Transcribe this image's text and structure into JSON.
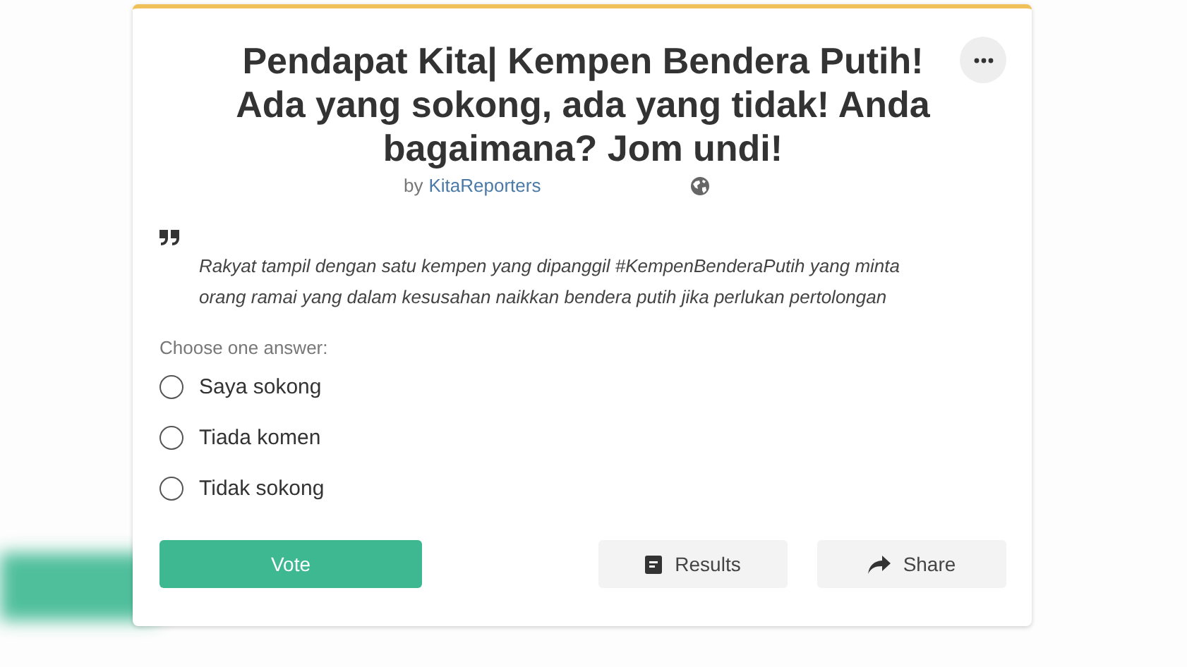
{
  "poll": {
    "title": "Pendapat Kita| Kempen Bendera Putih! Ada yang sokong, ada yang tidak! Anda bagaimana? Jom undi!",
    "byline": {
      "prefix": "by",
      "author": "KitaReporters"
    },
    "quote": "Rakyat tampil dengan satu kempen yang dipanggil #KempenBenderaPutih yang minta orang ramai yang dalam kesusahan naikkan bendera putih jika perlukan pertolongan",
    "prompt": "Choose one answer:",
    "options": [
      {
        "label": "Saya sokong",
        "selected": false
      },
      {
        "label": "Tiada komen",
        "selected": false
      },
      {
        "label": "Tidak sokong",
        "selected": false
      }
    ],
    "actions": [
      {
        "kind": "vote",
        "label": "Vote"
      },
      {
        "kind": "results",
        "label": "Results"
      },
      {
        "kind": "share",
        "label": "Share"
      }
    ]
  }
}
